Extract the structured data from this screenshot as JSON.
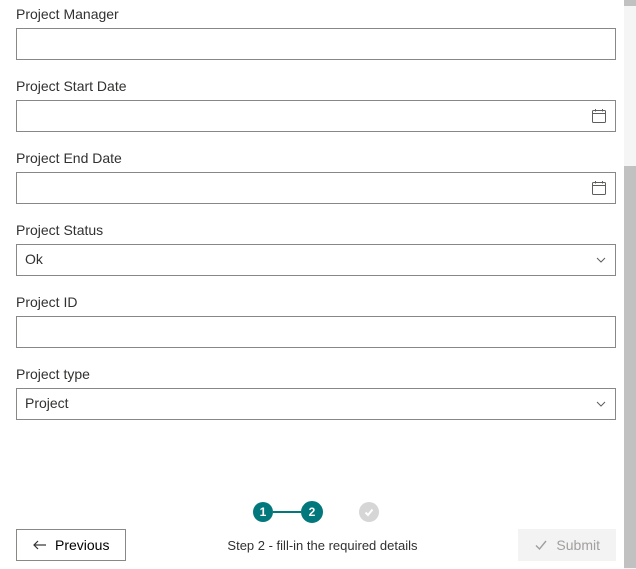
{
  "fields": {
    "project_manager": {
      "label": "Project Manager",
      "value": ""
    },
    "start_date": {
      "label": "Project Start Date",
      "value": ""
    },
    "end_date": {
      "label": "Project End Date",
      "value": ""
    },
    "status": {
      "label": "Project Status",
      "value": "Ok"
    },
    "project_id": {
      "label": "Project ID",
      "value": ""
    },
    "project_type": {
      "label": "Project type",
      "value": "Project"
    }
  },
  "stepper": {
    "step1": "1",
    "step2": "2",
    "hint": "Step 2 - fill-in the required details"
  },
  "buttons": {
    "previous": "Previous",
    "submit": "Submit"
  },
  "colors": {
    "accent": "#03787c",
    "border": "#8a8886",
    "muted": "#a19f9d"
  }
}
